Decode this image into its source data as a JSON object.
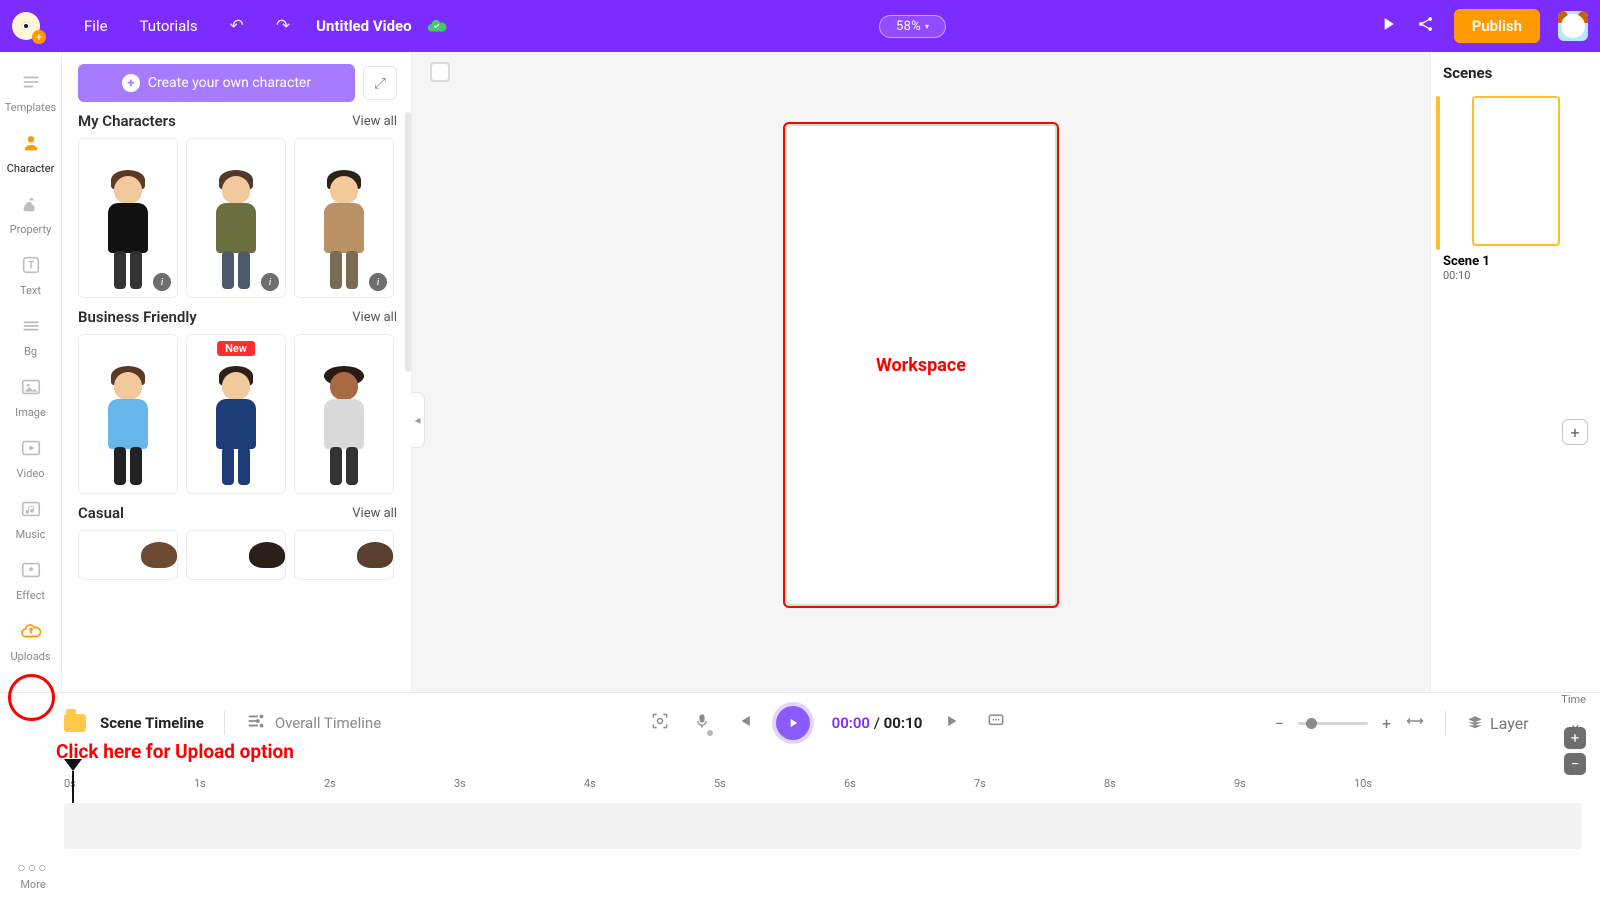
{
  "topbar": {
    "file": "File",
    "tutorials": "Tutorials",
    "title": "Untitled Video",
    "zoom": "58%",
    "publish": "Publish"
  },
  "rail": {
    "items": [
      {
        "label": "Templates"
      },
      {
        "label": "Character"
      },
      {
        "label": "Property"
      },
      {
        "label": "Text"
      },
      {
        "label": "Bg"
      },
      {
        "label": "Image"
      },
      {
        "label": "Video"
      },
      {
        "label": "Music"
      },
      {
        "label": "Effect"
      },
      {
        "label": "Uploads"
      }
    ],
    "more": "More"
  },
  "library": {
    "create_label": "Create your own character",
    "sections": [
      {
        "title": "My Characters",
        "view_all": "View all"
      },
      {
        "title": "Business Friendly",
        "view_all": "View all"
      },
      {
        "title": "Casual",
        "view_all": "View all"
      }
    ],
    "new_badge": "New"
  },
  "workspace_label": "Workspace",
  "scenes": {
    "title": "Scenes",
    "items": [
      {
        "name": "Scene 1",
        "time": "00:10"
      }
    ]
  },
  "timeline": {
    "scene_tab": "Scene Timeline",
    "overall_tab": "Overall Timeline",
    "current": "00:00",
    "sep": " / ",
    "total": "00:10",
    "layer": "Layer",
    "time_label": "Time",
    "ticks": [
      "0s",
      "1s",
      "2s",
      "3s",
      "4s",
      "5s",
      "6s",
      "7s",
      "8s",
      "9s",
      "10s"
    ]
  },
  "annotation": {
    "upload_note": "Click here for Upload option"
  }
}
